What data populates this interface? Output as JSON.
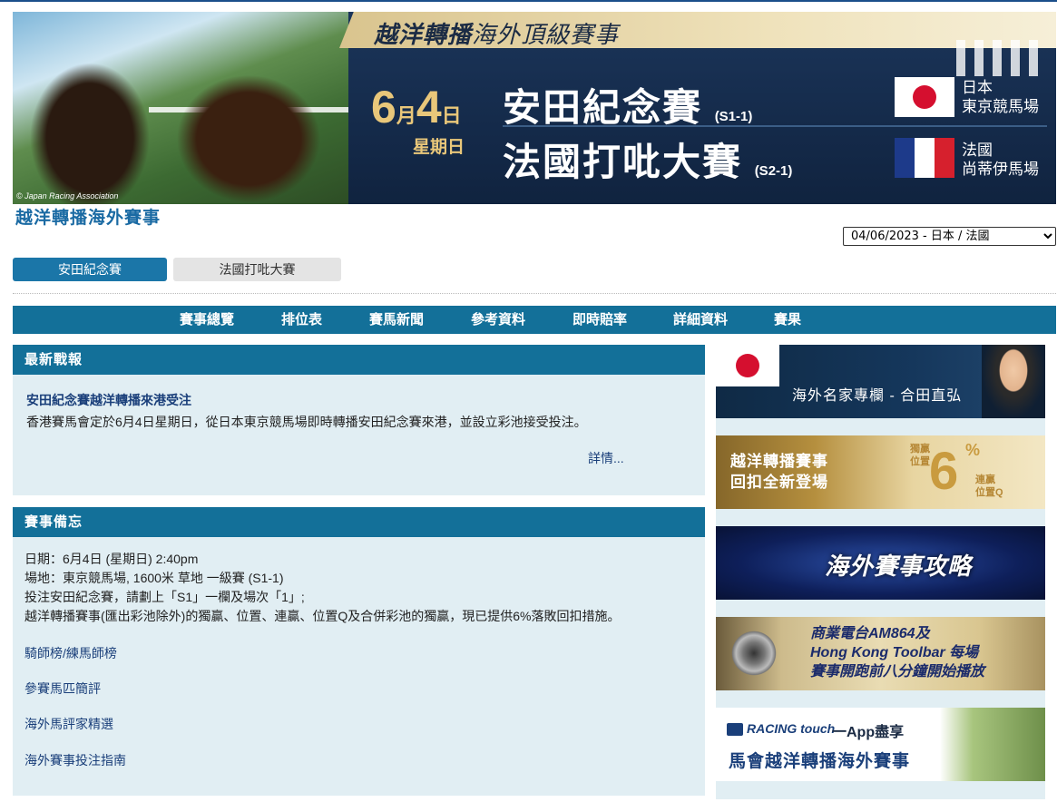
{
  "banner": {
    "tagline_bold": "越洋轉播",
    "tagline_rest": "海外頂級賽事",
    "date_month": "6",
    "date_month_unit": "月",
    "date_day": "4",
    "date_day_unit": "日",
    "weekday": "星期日",
    "race1_name": "安田紀念賽",
    "race1_code": "(S1-1)",
    "race2_name": "法國打吡大賽",
    "race2_code": "(S2-1)",
    "venue1_country": "日本",
    "venue1_course": "東京競馬場",
    "venue2_country": "法國",
    "venue2_course": "尚蒂伊馬場",
    "copyright": "© Japan Racing Association"
  },
  "page_subtitle": "越洋轉播海外賽事",
  "meeting_select": {
    "selected": "04/06/2023 - 日本 / 法國"
  },
  "race_tabs": [
    {
      "label": "安田紀念賽",
      "active": true
    },
    {
      "label": "法國打吡大賽",
      "active": false
    }
  ],
  "nav": {
    "items": [
      "賽事總覽",
      "排位表",
      "賽馬新聞",
      "參考資料",
      "即時賠率",
      "詳細資料",
      "賽果"
    ]
  },
  "news_panel": {
    "header": "最新戰報",
    "title": "安田紀念賽越洋轉播來港受注",
    "body": "香港賽馬會定於6月4日星期日，從日本東京競馬場即時轉播安田紀念賽來港，並設立彩池接受投注。",
    "more": "詳情..."
  },
  "memo_panel": {
    "header": "賽事備忘",
    "lines": [
      "日期：6月4日 (星期日) 2:40pm",
      "場地：東京競馬場, 1600米 草地 一級賽 (S1-1)",
      "投注安田紀念賽，請劃上「S1」一欄及場次「1」;",
      "越洋轉播賽事(匯出彩池除外)的獨贏、位置、連贏、位置Q及合併彩池的獨贏，現已提供6%落敗回扣措施。"
    ],
    "links": [
      "騎師榜/練馬師榜",
      "參賽馬匹簡評",
      "海外馬評家精選",
      "海外賽事投注指南"
    ]
  },
  "sidebar": {
    "ad1_text": "海外名家專欄 - 合田直弘",
    "ad2_line1": "越洋轉播賽事",
    "ad2_line2": "回扣全新登場",
    "ad2_big": "6",
    "ad2_pct": "%",
    "ad2_lbl_win": "獨贏",
    "ad2_lbl_place": "位置",
    "ad2_lbl_q": "連贏",
    "ad2_lbl_pq": "位置Q",
    "ad3_text": "海外賽事攻略",
    "ad4_line1": "商業電台AM864及",
    "ad4_line2": "Hong Kong Toolbar 每場",
    "ad4_line3": "賽事開跑前八分鐘開始播放",
    "ad5_logo": "RACING touch",
    "ad5_app": "一App盡享",
    "ad5_text": "馬會越洋轉播海外賽事"
  }
}
